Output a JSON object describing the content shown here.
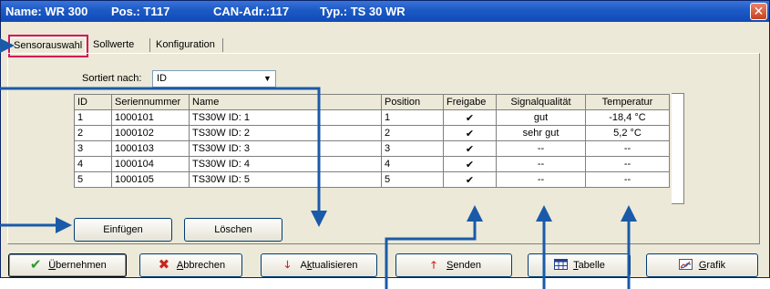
{
  "title": {
    "name": "Name: WR 300",
    "pos": "Pos.: T117",
    "can": "CAN-Adr.:117",
    "typ": "Typ.: TS 30 WR",
    "close_glyph": "✕"
  },
  "tabs": [
    {
      "label": "Sensorauswahl"
    },
    {
      "label": "Sollwerte"
    },
    {
      "label": "Konfiguration"
    }
  ],
  "sort": {
    "label": "Sortiert nach:",
    "value": "ID"
  },
  "table": {
    "headers": [
      "ID",
      "Seriennummer",
      "Name",
      "Position",
      "Freigabe",
      "Signalqualität",
      "Temperatur"
    ],
    "rows": [
      {
        "id": "1",
        "serial": "1000101",
        "name": "TS30W ID: 1",
        "position": "1",
        "freigabe": "✔",
        "signal": "gut",
        "temp": "-18,4 °C"
      },
      {
        "id": "2",
        "serial": "1000102",
        "name": "TS30W ID: 2",
        "position": "2",
        "freigabe": "✔",
        "signal": "sehr gut",
        "temp": "5,2 °C"
      },
      {
        "id": "3",
        "serial": "1000103",
        "name": "TS30W ID: 3",
        "position": "3",
        "freigabe": "✔",
        "signal": "--",
        "temp": "--"
      },
      {
        "id": "4",
        "serial": "1000104",
        "name": "TS30W ID: 4",
        "position": "4",
        "freigabe": "✔",
        "signal": "--",
        "temp": "--"
      },
      {
        "id": "5",
        "serial": "1000105",
        "name": "TS30W ID: 5",
        "position": "5",
        "freigabe": "✔",
        "signal": "--",
        "temp": "--"
      }
    ]
  },
  "panel_buttons": {
    "insert": "Einfügen",
    "delete": "Löschen"
  },
  "bottom_buttons": {
    "apply": {
      "u": "Ü",
      "rest": "bernehmen"
    },
    "cancel": {
      "u": "A",
      "rest": "bbrechen"
    },
    "refresh": {
      "pre": "A",
      "u": "k",
      "rest": "tualisieren"
    },
    "send": {
      "u": "S",
      "rest": "enden"
    },
    "table": {
      "u": "T",
      "rest": "abelle"
    },
    "chart": {
      "u": "G",
      "rest": "rafik"
    }
  },
  "icons": {
    "apply": "check-icon",
    "cancel": "x-icon",
    "refresh": "arrow-down-icon",
    "send": "arrow-up-icon",
    "table": "table-icon",
    "chart": "chart-icon"
  },
  "colors": {
    "titlebar": "#1e5bc6",
    "annotation_arrow": "#1a5aa8",
    "tab_highlight": "#d4145a"
  }
}
